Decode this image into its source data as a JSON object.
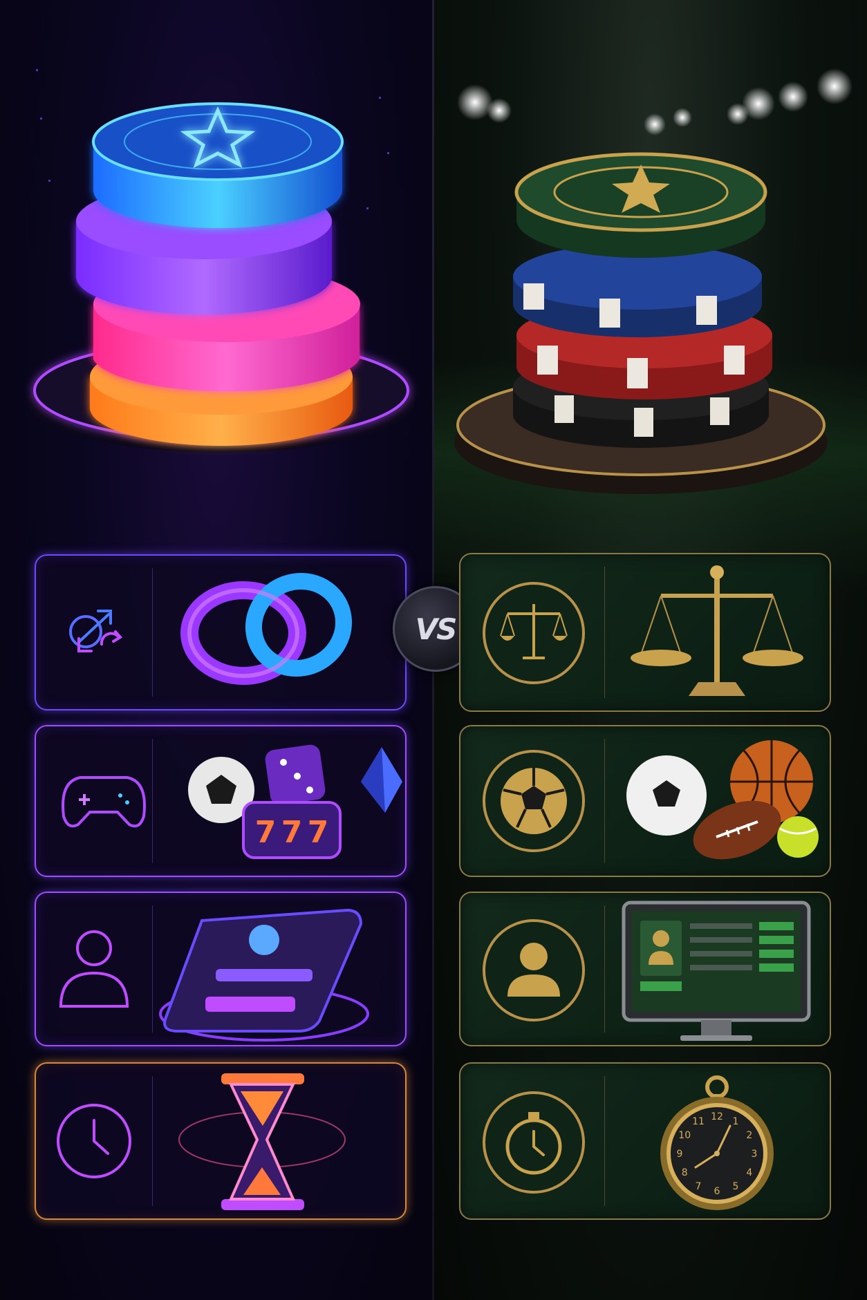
{
  "versus": {
    "label": "VS"
  },
  "left_theme": {
    "name": "neon-online-casino",
    "colors": {
      "blue": "#2aa8ff",
      "violet": "#8a3cff",
      "pink": "#ff3fc4",
      "orange": "#ff8a2a",
      "border": "#6a4cff"
    }
  },
  "right_theme": {
    "name": "classic-sportsbook",
    "colors": {
      "green": "#1f4a2c",
      "gold": "#c9a24e",
      "blue": "#1f3f8a",
      "red": "#a42424",
      "black": "#141414"
    }
  },
  "left_cards": [
    {
      "icon": "exchange-arrows-icon",
      "image": "linked-rings-illustration"
    },
    {
      "icon": "gamepad-icon",
      "image": "casino-games-illustration"
    },
    {
      "icon": "user-icon",
      "image": "mobile-app-illustration"
    },
    {
      "icon": "clock-icon",
      "image": "hourglass-illustration"
    }
  ],
  "right_cards": [
    {
      "icon": "scales-icon",
      "image": "balance-scale-illustration"
    },
    {
      "icon": "soccer-ball-icon",
      "image": "sports-balls-illustration"
    },
    {
      "icon": "user-icon",
      "image": "betting-monitor-illustration"
    },
    {
      "icon": "stopwatch-icon",
      "image": "pocket-watch-illustration"
    }
  ],
  "watch_numerals": [
    "12",
    "1",
    "2",
    "3",
    "4",
    "5",
    "6",
    "7",
    "8",
    "9",
    "10",
    "11"
  ],
  "slot_reels": [
    "7",
    "7",
    "7"
  ]
}
